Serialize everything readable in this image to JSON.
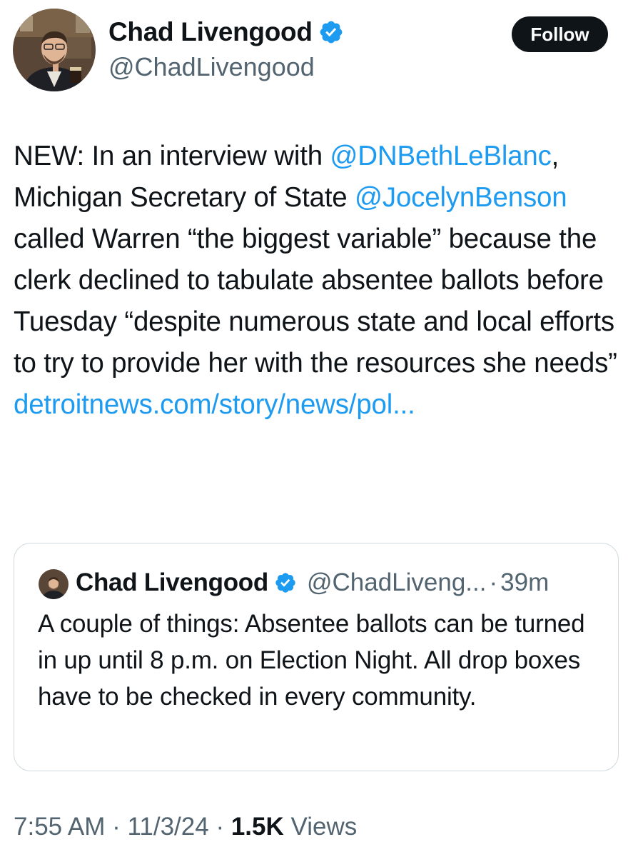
{
  "author": {
    "display_name": "Chad Livengood",
    "handle": "@ChadLivengood",
    "verified_color": "#1d9bf0"
  },
  "follow_button": {
    "label": "Follow"
  },
  "tweet": {
    "text_1": "NEW: In an interview with ",
    "mention_1": "@DNBethLeBlanc",
    "text_2": ", Michigan Secretary of State ",
    "mention_2": "@JocelynBenson",
    "text_3": " called Warren “the biggest variable” because the clerk declined to tabulate absentee ballots before Tuesday “despite numerous state and local efforts to try to provide her with the resources she needs”",
    "link": "detroitnews.com/story/news/pol..."
  },
  "quote": {
    "display_name": "Chad Livengood",
    "handle": "@ChadLiveng...",
    "separator": "·",
    "time": "39m",
    "text": "A couple of things: Absentee ballots can be turned in up until 8 p.m. on Election Night. All drop boxes have to be checked in every community."
  },
  "meta": {
    "time": "7:55 AM",
    "sep_1": " · ",
    "date": "11/3/24",
    "sep_2": " · ",
    "views_count": "1.5K",
    "views_label": " Views"
  },
  "icons": {
    "verified": "verified-badge-icon"
  }
}
